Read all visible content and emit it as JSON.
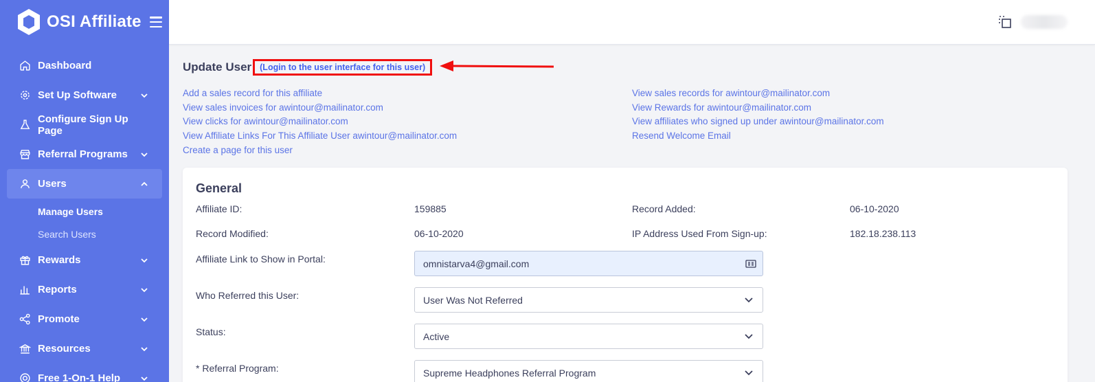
{
  "brand": {
    "name": "OSI Affiliate"
  },
  "sidebar": {
    "items": [
      {
        "label": "Dashboard",
        "icon": "home-icon",
        "has_chevron": false
      },
      {
        "label": "Set Up Software",
        "icon": "gear-icon",
        "has_chevron": true
      },
      {
        "label": "Configure Sign Up Page",
        "icon": "flask-icon",
        "has_chevron": false
      },
      {
        "label": "Referral Programs",
        "icon": "store-icon",
        "has_chevron": true
      },
      {
        "label": "Users",
        "icon": "user-icon",
        "has_chevron": true,
        "active": true
      },
      {
        "label": "Rewards",
        "icon": "gift-icon",
        "has_chevron": true
      },
      {
        "label": "Reports",
        "icon": "bar-chart-icon",
        "has_chevron": true
      },
      {
        "label": "Promote",
        "icon": "share-icon",
        "has_chevron": true
      },
      {
        "label": "Resources",
        "icon": "bank-icon",
        "has_chevron": true
      },
      {
        "label": "Free 1-On-1 Help",
        "icon": "lifebuoy-icon",
        "has_chevron": true
      }
    ],
    "sub_items": [
      {
        "label": "Manage Users",
        "current": true
      },
      {
        "label": "Search Users",
        "current": false
      }
    ]
  },
  "page": {
    "title": "Update User",
    "login_link": "(Login to the user interface for this user)"
  },
  "links": {
    "left": [
      "Add a sales record for this affiliate",
      "View sales invoices for awintour@mailinator.com",
      "View clicks for awintour@mailinator.com",
      "View Affiliate Links For This Affiliate User awintour@mailinator.com",
      "Create a page for this user"
    ],
    "right": [
      "View sales records for awintour@mailinator.com",
      "View Rewards for awintour@mailinator.com",
      "View affiliates who signed up under awintour@mailinator.com",
      "Resend Welcome Email"
    ]
  },
  "general": {
    "title": "General",
    "affiliate_id_label": "Affiliate ID:",
    "affiliate_id": "159885",
    "record_added_label": "Record Added:",
    "record_added": "06-10-2020",
    "record_modified_label": "Record Modified:",
    "record_modified": "06-10-2020",
    "ip_label": "IP Address Used From Sign-up:",
    "ip": "182.18.238.113",
    "affiliate_link_label": "Affiliate Link to Show in Portal:",
    "affiliate_link_value": "omnistarva4@gmail.com",
    "referred_label": "Who Referred this User:",
    "referred_value": "User Was Not Referred",
    "status_label": "Status:",
    "status_value": "Active",
    "referral_program_label": "* Referral Program:",
    "referral_program_value": "Supreme Headphones Referral Program"
  },
  "colors": {
    "sidebar_bg": "#5b74e6",
    "link": "#5b74e6",
    "highlight_box": "#f00f0f"
  }
}
